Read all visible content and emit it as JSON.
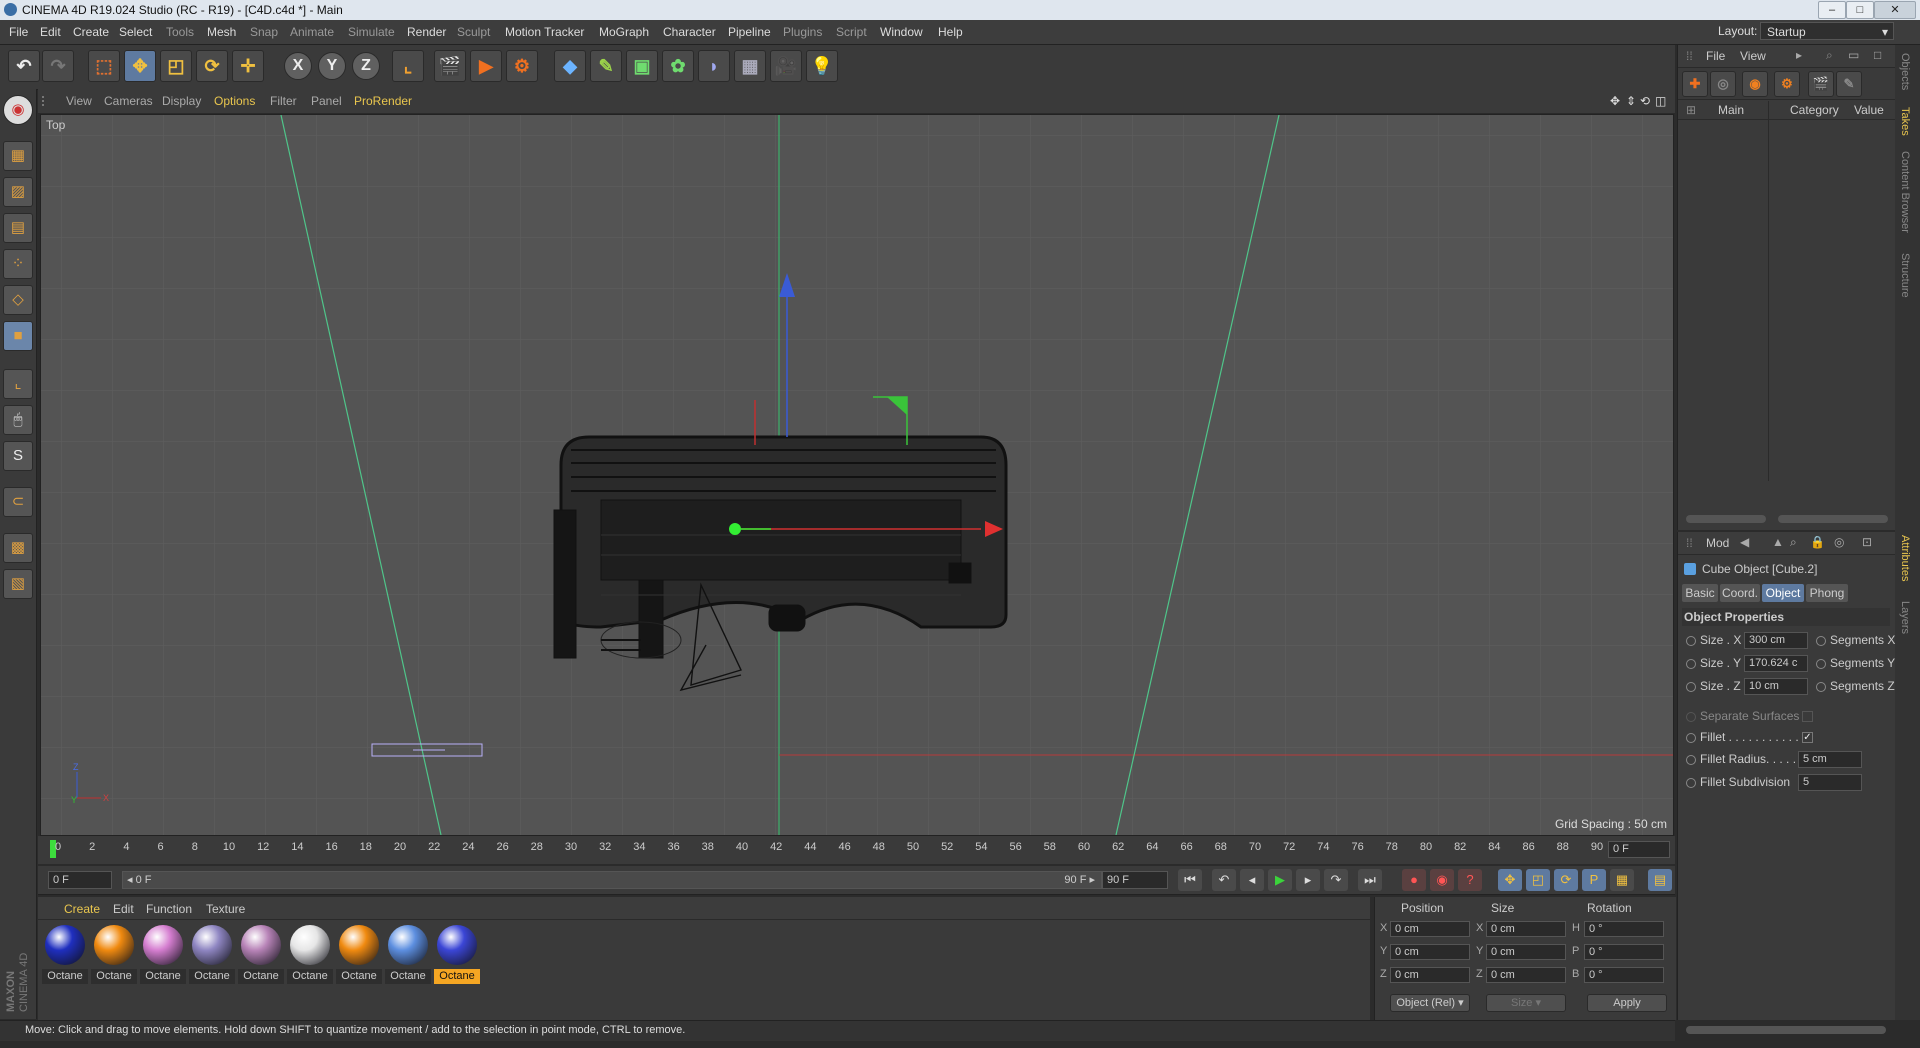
{
  "window": {
    "title": "CINEMA 4D R19.024 Studio (RC - R19) - [C4D.c4d *] - Main"
  },
  "menu": [
    "File",
    "Edit",
    "Create",
    "Select",
    "Tools",
    "Mesh",
    "Snap",
    "Animate",
    "Simulate",
    "Render",
    "Sculpt",
    "Motion Tracker",
    "MoGraph",
    "Character",
    "Pipeline",
    "Plugins",
    "Script",
    "Window",
    "Help"
  ],
  "layout": {
    "label": "Layout:",
    "value": "Startup"
  },
  "toolbar": {
    "axis_x": "X",
    "axis_y": "Y",
    "axis_z": "Z"
  },
  "viewport": {
    "menu": [
      "View",
      "Cameras",
      "Display",
      "Options",
      "Filter",
      "Panel",
      "ProRender"
    ],
    "camera_label": "Top",
    "grid_spacing": "Grid Spacing : 50 cm"
  },
  "timeline": {
    "ticks": [
      "0",
      "2",
      "4",
      "6",
      "8",
      "10",
      "12",
      "14",
      "16",
      "18",
      "20",
      "22",
      "24",
      "26",
      "28",
      "30",
      "32",
      "34",
      "36",
      "38",
      "40",
      "42",
      "44",
      "46",
      "48",
      "50",
      "52",
      "54",
      "56",
      "58",
      "60",
      "62",
      "64",
      "66",
      "68",
      "70",
      "72",
      "74",
      "76",
      "78",
      "80",
      "82",
      "84",
      "86",
      "88",
      "90"
    ],
    "current_frame": "0 F",
    "start_field": "0 F",
    "range_start": "◂ 0 F",
    "range_end": "90 F ▸",
    "end_field": "90 F"
  },
  "materials": {
    "menu": [
      "Create",
      "Edit",
      "Function",
      "Texture"
    ],
    "items": [
      {
        "label": "Octane",
        "color": "#1f2fbf"
      },
      {
        "label": "Octane",
        "color": "#f08a10"
      },
      {
        "label": "Octane",
        "color": "#d57ed0"
      },
      {
        "label": "Octane",
        "color": "#8f86c2"
      },
      {
        "label": "Octane",
        "color": "#b884b8"
      },
      {
        "label": "Octane",
        "color": "#e6e6e6"
      },
      {
        "label": "Octane",
        "color": "#f08a10"
      },
      {
        "label": "Octane",
        "color": "#5d8fe0"
      },
      {
        "label": "Octane",
        "color": "#3b46d6"
      }
    ]
  },
  "coordinates": {
    "headers": [
      "Position",
      "Size",
      "Rotation"
    ],
    "rows": [
      {
        "axis": "X",
        "pos": "0 cm",
        "saxis": "X",
        "size": "0 cm",
        "raxis": "H",
        "rot": "0 °"
      },
      {
        "axis": "Y",
        "pos": "0 cm",
        "saxis": "Y",
        "size": "0 cm",
        "raxis": "P",
        "rot": "0 °"
      },
      {
        "axis": "Z",
        "pos": "0 cm",
        "saxis": "Z",
        "size": "0 cm",
        "raxis": "B",
        "rot": "0 °"
      }
    ],
    "mode": "Object (Rel)",
    "size_mode": "Size",
    "apply": "Apply"
  },
  "status": "Move: Click and drag to move elements. Hold down SHIFT to quantize movement / add to the selection in point mode, CTRL to remove.",
  "branding": "MAXON CINEMA 4D",
  "object_manager": {
    "menu": [
      "File",
      "View"
    ],
    "columns": [
      "Main",
      "Category",
      "Value"
    ]
  },
  "attributes": {
    "menu": "Mod",
    "object_title": "Cube Object [Cube.2]",
    "tabs": [
      "Basic",
      "Coord.",
      "Object",
      "Phong"
    ],
    "section": "Object Properties",
    "size_x_label": "Size . X",
    "size_x": "300 cm",
    "seg_x": "Segments X",
    "size_y_label": "Size . Y",
    "size_y": "170.624 c",
    "seg_y": "Segments Y",
    "size_z_label": "Size . Z",
    "size_z": "10 cm",
    "seg_z": "Segments Z",
    "separate": "Separate Surfaces",
    "fillet": "Fillet . . . . . . . . . . .",
    "fillet_check": "✓",
    "fillet_radius_label": "Fillet Radius. . . . .",
    "fillet_radius": "5 cm",
    "fillet_sub_label": "Fillet Subdivision",
    "fillet_sub": "5"
  },
  "right_tabs": [
    "Objects",
    "Takes",
    "Content Browser",
    "Structure",
    "Attributes",
    "Layers"
  ]
}
